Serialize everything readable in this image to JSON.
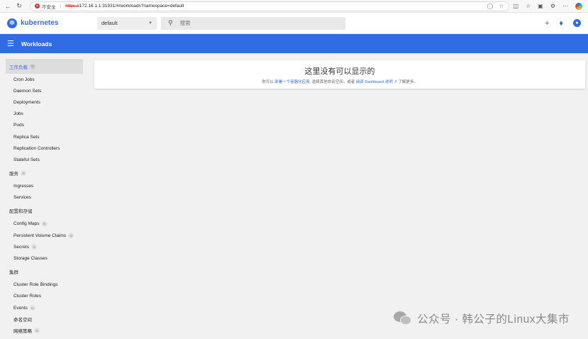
{
  "browser": {
    "security_label": "不安全",
    "url_scheme": "https://",
    "url_rest": "172.16.1.1:31931/#/workloads?namespace=default"
  },
  "header": {
    "brand": "kubernetes",
    "namespace_value": "default",
    "search_placeholder": "搜索"
  },
  "titlebar": {
    "title": "Workloads"
  },
  "sidebar": {
    "groups": [
      {
        "label": "工作负载",
        "badge": "N",
        "items": [
          "Cron Jobs",
          "Daemon Sets",
          "Deployments",
          "Jobs",
          "Pods",
          "Replica Sets",
          "Replication Controllers",
          "Stateful Sets"
        ]
      },
      {
        "label": "服务",
        "badge": "N",
        "items": [
          "Ingresses",
          "Services"
        ]
      },
      {
        "label": "配置和存储",
        "items": [
          "Config Maps",
          "Persistent Volume Claims",
          "Secrets",
          "Storage Classes"
        ]
      },
      {
        "label": "集群",
        "items": [
          "Cluster Role Bindings",
          "Cluster Roles",
          "Events",
          "命名空间",
          "网络策略"
        ]
      }
    ],
    "item_badges": {
      "Config Maps": "N",
      "Persistent Volume Claims": "N",
      "Secrets": "N",
      "Events": "N",
      "网络策略": "N"
    }
  },
  "empty_state": {
    "title": "这里没有可以显示的",
    "sub_prefix": "你可以",
    "sub_link1": "部署一个容器化应用",
    "sub_middle": ", 选择其他命名空间，或者",
    "sub_link2": "阅读 Dashboard 说明",
    "sub_suffix": "了解更多。"
  },
  "watermark": {
    "text": "公众号 · 韩公子的Linux大集市"
  },
  "colors": {
    "accent": "#326ce5",
    "danger": "#d93025"
  }
}
